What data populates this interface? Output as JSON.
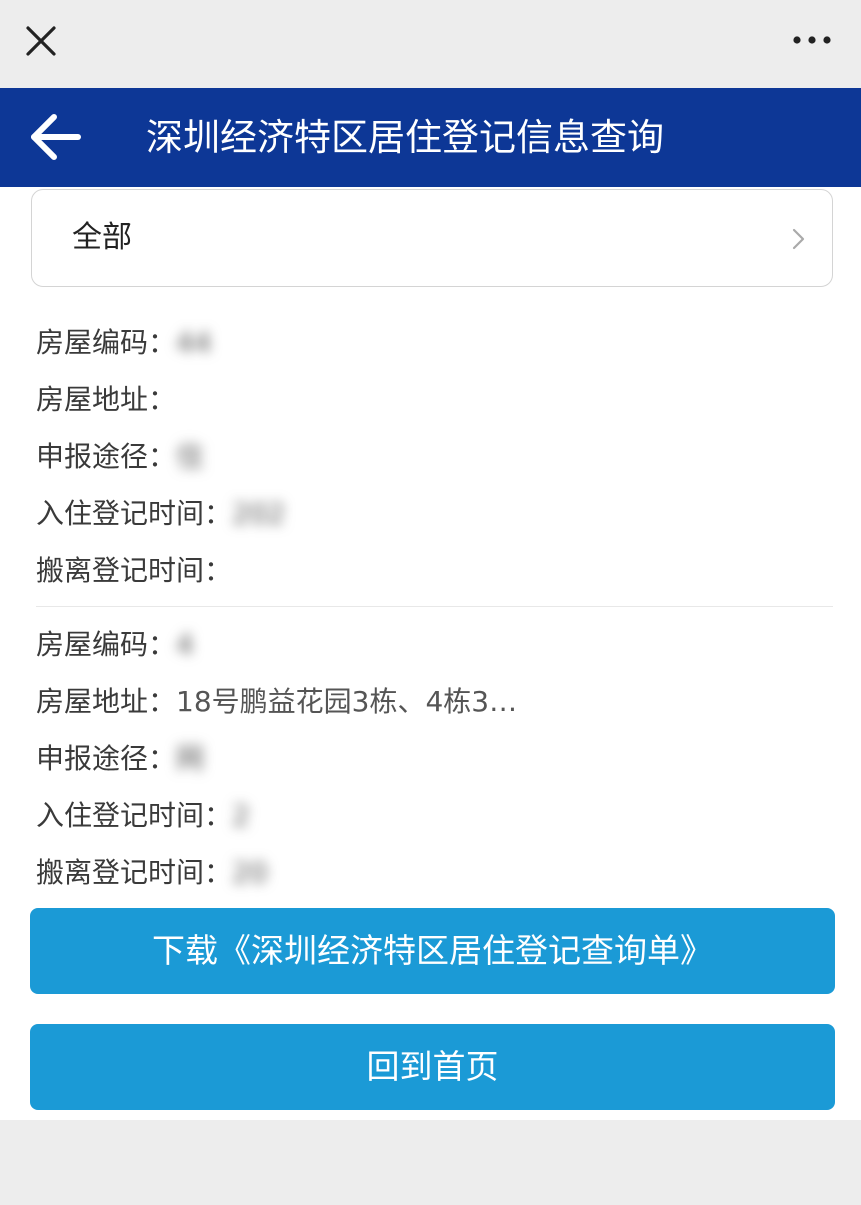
{
  "browser": {
    "close_icon": "close-icon",
    "more_icon": "more-dots-icon"
  },
  "header": {
    "back_icon": "back-arrow-icon",
    "title": "深圳经济特区居住登记信息查询"
  },
  "filter": {
    "label": "全部",
    "chevron_icon": "chevron-right-icon"
  },
  "records": [
    {
      "house_code_label": "房屋编码：",
      "house_code": "44",
      "address_label": "房屋地址：",
      "address": "",
      "channel_label": "申报途径：",
      "channel": "住",
      "checkin_label": "入住登记时间：",
      "checkin": "202",
      "checkout_label": "搬离登记时间：",
      "checkout": ""
    },
    {
      "house_code_label": "房屋编码：",
      "house_code": "4",
      "address_label": "房屋地址：",
      "address": "18号鹏益花园3栋、4栋3…",
      "channel_label": "申报途径：",
      "channel": "网",
      "checkin_label": "入住登记时间：",
      "checkin": "2",
      "checkout_label": "搬离登记时间：",
      "checkout": "20"
    }
  ],
  "buttons": {
    "download": "下载《深圳经济特区居住登记查询单》",
    "home": "回到首页"
  },
  "colors": {
    "header_bg": "#0d3796",
    "button_bg": "#1b9ad6",
    "page_bg": "#ededed"
  }
}
